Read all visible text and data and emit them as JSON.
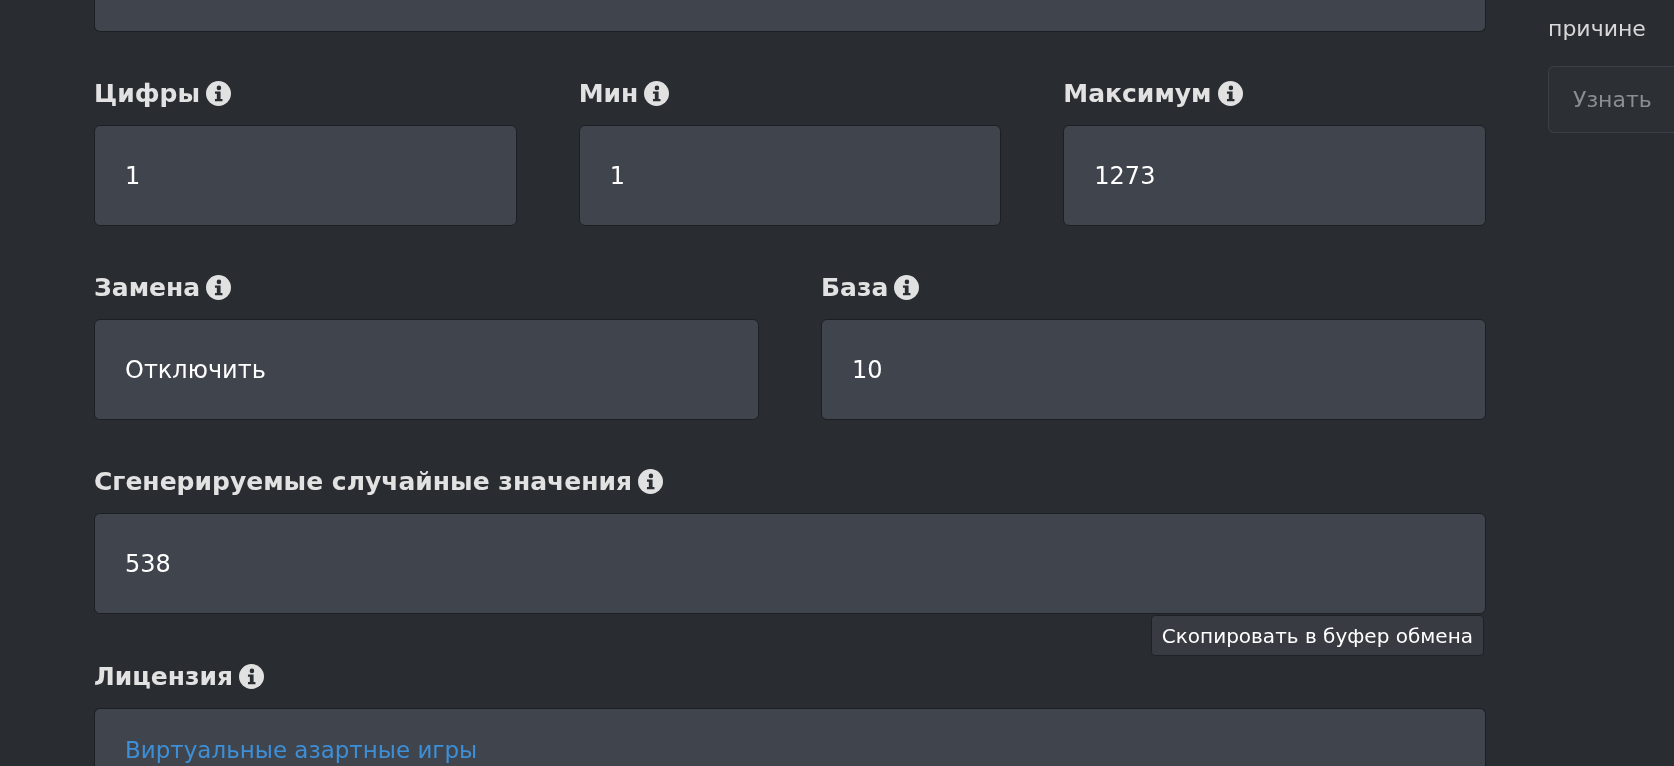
{
  "form": {
    "rows": [
      {
        "fields": [
          {
            "label": "Цифры",
            "value": "1"
          },
          {
            "label": "Мин",
            "value": "1"
          },
          {
            "label": "Максимум",
            "value": "1273"
          }
        ]
      },
      {
        "fields": [
          {
            "label": "Замена",
            "value": "Отключить"
          },
          {
            "label": "База",
            "value": "10"
          }
        ]
      },
      {
        "fields": [
          {
            "label": "Сгенерируемые случайные значения",
            "value": "538"
          }
        ]
      }
    ],
    "copy_button": {
      "label": "Скопировать в буфер обмена"
    },
    "license": {
      "label": "Лицензия",
      "link": "Виртуальные азартные игры"
    }
  },
  "sidebar": {
    "text": "причине",
    "button": "Узнать"
  }
}
